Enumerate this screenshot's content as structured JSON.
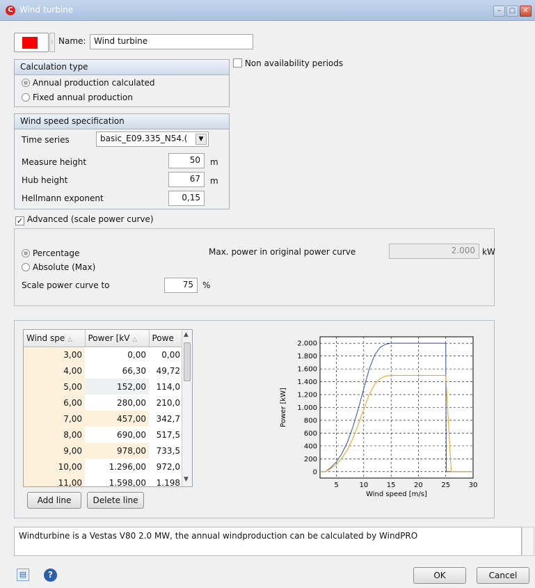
{
  "window": {
    "title": "Wind turbine",
    "buttons": {
      "minimize": "–",
      "maximize": "□",
      "close": "✕"
    }
  },
  "header": {
    "color_swatch": "#ff0000",
    "name_label": "Name:",
    "name_value": "Wind turbine",
    "non_availability_label": "Non availability periods",
    "non_availability_checked": false
  },
  "calc_type": {
    "title": "Calculation type",
    "options": [
      "Annual production calculated",
      "Fixed annual production"
    ],
    "selected_index": 0
  },
  "wind_spec": {
    "title": "Wind speed specification",
    "time_series_label": "Time series",
    "time_series_value": "basic_E09.335_N54.(",
    "measure_height_label": "Measure height",
    "measure_height_value": "50",
    "hub_height_label": "Hub height",
    "hub_height_value": "67",
    "hellmann_label": "Hellmann exponent",
    "hellmann_value": "0,15",
    "unit_m": "m"
  },
  "advanced": {
    "label": "Advanced (scale power curve)",
    "checked": true,
    "options": [
      "Percentage",
      "Absolute (Max)"
    ],
    "selected_index": 0,
    "scale_label": "Scale power curve to",
    "scale_value": "75",
    "scale_unit": "%",
    "max_power_label": "Max. power in original power curve",
    "max_power_value": "2.000",
    "max_power_unit": "kW"
  },
  "table": {
    "headers": [
      "Wind spe",
      "Power [kV",
      "Powe"
    ],
    "rows": [
      [
        "3,00",
        "0,00",
        "0,00"
      ],
      [
        "4,00",
        "66,30",
        "49,72"
      ],
      [
        "5,00",
        "152,00",
        "114,0"
      ],
      [
        "6,00",
        "280,00",
        "210,0"
      ],
      [
        "7,00",
        "457,00",
        "342,7"
      ],
      [
        "8,00",
        "690,00",
        "517,5"
      ],
      [
        "9,00",
        "978,00",
        "733,5"
      ],
      [
        "10,00",
        "1.296,00",
        "972,0"
      ],
      [
        "11,00",
        "1.598,00",
        "1.198"
      ]
    ],
    "add_line_label": "Add line",
    "delete_line_label": "Delete line"
  },
  "chart_data": {
    "type": "line",
    "xlabel": "Wind speed [m/s]",
    "ylabel": "Power [kW]",
    "xlim": [
      2,
      30
    ],
    "ylim": [
      -100,
      2100
    ],
    "x_ticks": [
      5,
      10,
      15,
      20,
      25,
      30
    ],
    "y_ticks": [
      0,
      200,
      400,
      600,
      800,
      1000,
      1200,
      1400,
      1600,
      1800,
      2000
    ],
    "y_tick_labels": [
      "0",
      "200",
      "400",
      "600",
      "800",
      "1.000",
      "1.200",
      "1.400",
      "1.600",
      "1.800",
      "2.000"
    ],
    "grid": true,
    "series": [
      {
        "color": "#3d5fa8",
        "x": [
          2,
          3,
          4,
          5,
          6,
          7,
          8,
          9,
          10,
          11,
          12,
          13,
          14,
          15,
          16,
          25,
          25.1,
          26,
          30
        ],
        "y": [
          0,
          0,
          66.3,
          152,
          280,
          457,
          690,
          978,
          1296,
          1598,
          1818,
          1935,
          1985,
          2000,
          2000,
          2000,
          0,
          0,
          0
        ]
      },
      {
        "color": "#f5a623",
        "x": [
          2,
          3,
          4,
          5,
          6,
          7,
          8,
          9,
          10,
          11,
          12,
          13,
          14,
          15,
          16,
          25,
          26,
          27,
          30
        ],
        "y": [
          0,
          0,
          49.72,
          114,
          210,
          342.7,
          517.5,
          733.5,
          972,
          1198.5,
          1363.5,
          1451,
          1489,
          1500,
          1500,
          1500,
          0,
          0,
          0
        ]
      }
    ]
  },
  "description": "Windturbine is a Vestas V80 2.0 MW, the annual windproduction can be calculated by WindPRO",
  "footer": {
    "ok_label": "OK",
    "cancel_label": "Cancel"
  }
}
